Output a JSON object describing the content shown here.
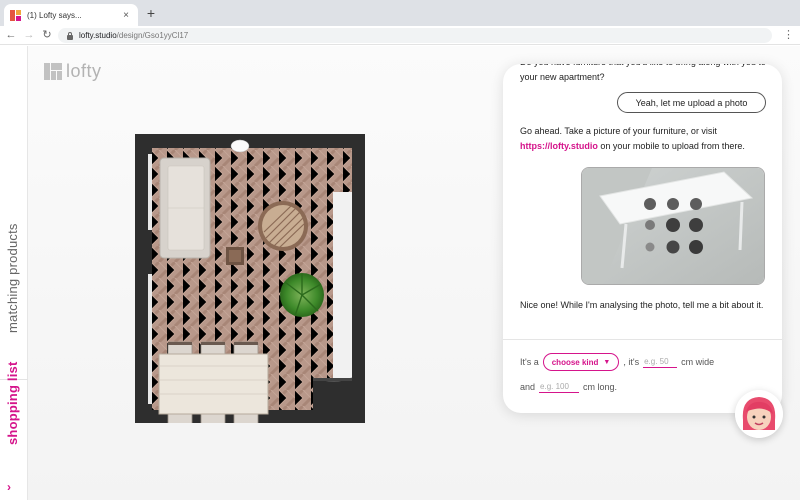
{
  "browser": {
    "tab_title": "(1) Lofty says...",
    "tab_close": "×",
    "new_tab": "+",
    "url_host": "lofty.studio",
    "url_path": "/design/Gso1yyCl17"
  },
  "app": {
    "logo_text": "lofty",
    "brand_color": "#d5148b"
  },
  "sidebar": {
    "items": [
      {
        "label": "matching products"
      },
      {
        "label": "shopping list"
      }
    ],
    "chevron": "›"
  },
  "chat": {
    "messages": {
      "top": "Do you have furniture that you'd like to bring along with you to your new apartment?",
      "reply_button": "Yeah, let me upload a photo",
      "upload_prefix": "Go ahead. Take a picture of your furniture, or visit ",
      "upload_link": "https://lofty.studio",
      "upload_suffix": " on your mobile to upload from there.",
      "analysing": "Nice one! While I'm analysing the photo, tell me a bit about it."
    },
    "form": {
      "its_a": "It's a",
      "kind_select": "choose kind",
      "its": ", it's",
      "width_placeholder": "e.g. 50",
      "cm_wide": "cm wide",
      "and": "and",
      "length_placeholder": "e.g. 100",
      "cm_long": "cm long."
    }
  }
}
